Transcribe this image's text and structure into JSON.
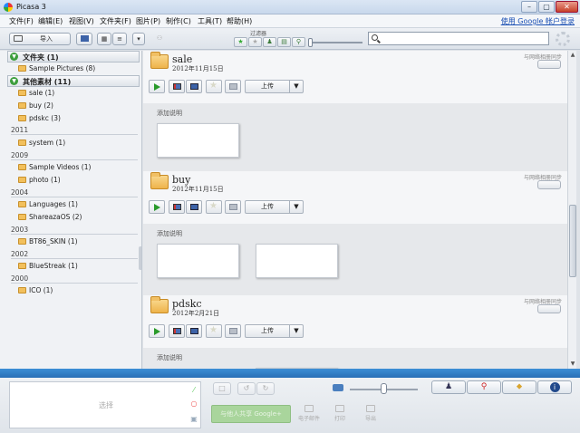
{
  "window": {
    "title": "Picasa 3",
    "min": "–",
    "max": "▢",
    "close": "✕"
  },
  "menu": {
    "items": [
      "文件(F)",
      "编辑(E)",
      "视图(V)",
      "文件夹(F)",
      "图片(P)",
      "制作(C)",
      "工具(T)",
      "帮助(H)"
    ],
    "signin": "使用 Google 帐户登录"
  },
  "toolbar": {
    "import_label": "导入",
    "filter_label": "过滤器",
    "search": {
      "value": "",
      "placeholder": ""
    }
  },
  "sidebar": {
    "groups": [
      {
        "label": "文件夹 (1)"
      },
      {
        "label": "其他素材 (11)"
      }
    ],
    "folders": [
      "Sample Pictures (8)",
      "sale (1)",
      "buy (2)",
      "pdskc (3)",
      "system (1)",
      "Sample Videos (1)",
      "photo (1)",
      "Languages (1)",
      "ShareazaOS (2)",
      "BT86_SKIN (1)",
      "BlueStreak (1)",
      "ICO (1)"
    ],
    "years": [
      "2011",
      "2009",
      "2004",
      "2003",
      "2002",
      "2000"
    ]
  },
  "albums": [
    {
      "name": "sale",
      "date": "2012年11月15日",
      "sync": "与网络相册同步",
      "upload": "上传",
      "caption": "添加说明",
      "thumbs": 1
    },
    {
      "name": "buy",
      "date": "2012年11月15日",
      "sync": "与网络相册同步",
      "upload": "上传",
      "caption": "添加说明",
      "thumbs": 2
    },
    {
      "name": "pdskc",
      "date": "2012年2月21日",
      "sync": "与网络相册同步",
      "upload": "上传",
      "caption": "添加说明",
      "thumbs": 1
    }
  ],
  "tray": {
    "holder_label": "选择",
    "share_label": "与他人共享 Google+",
    "email_label": "电子邮件",
    "print_label": "打印",
    "export_label": "导出"
  },
  "colors": {
    "accent_bar": "#2f7ac3",
    "share_green": "#a9d59c"
  }
}
